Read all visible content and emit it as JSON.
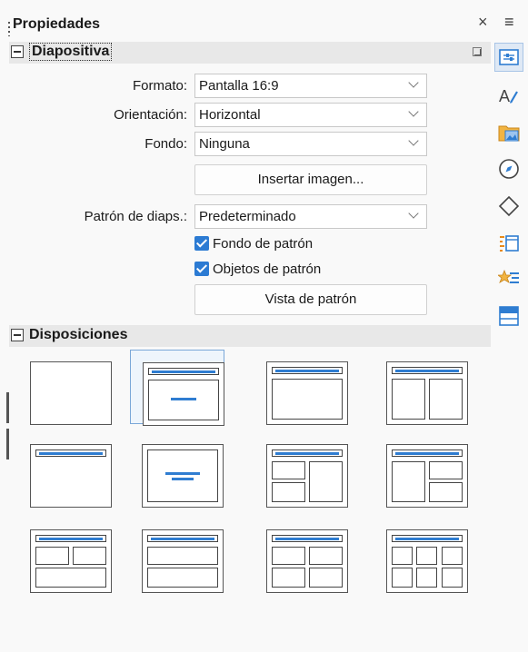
{
  "header": {
    "title": "Propiedades",
    "close_symbol": "×",
    "menu_symbol": "≡"
  },
  "slide_section": {
    "title": "Diapositiva",
    "format": {
      "label": "Formato:",
      "value": "Pantalla 16:9"
    },
    "orientation": {
      "label": "Orientación:",
      "value": "Horizontal"
    },
    "background": {
      "label": "Fondo:",
      "value": "Ninguna"
    },
    "insert_image_label": "Insertar imagen...",
    "master": {
      "label": "Patrón de diaps.:",
      "value": "Predeterminado"
    },
    "master_background_label": "Fondo de patrón",
    "master_objects_label": "Objetos de patrón",
    "master_view_label": "Vista de patrón"
  },
  "layouts_section": {
    "title": "Disposiciones"
  },
  "colors": {
    "accent": "#2f7dd1",
    "checkbox": "#2c7bd3",
    "selection": "#7aa7d8"
  }
}
